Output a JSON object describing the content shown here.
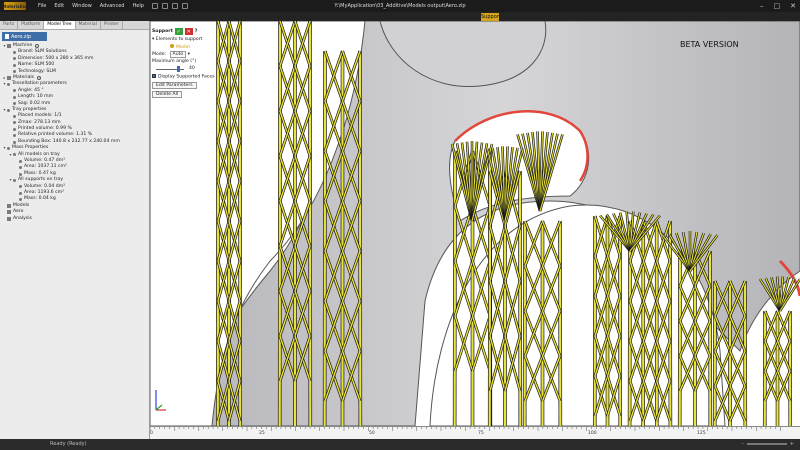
{
  "app": {
    "logo": "Materialise",
    "menu": [
      "File",
      "Edit",
      "Window",
      "Advanced",
      "Help"
    ],
    "path": "Y:\\MyApplication\\03_Additive\\Models output\\Aero.zip",
    "context_tab": "Support",
    "window_controls": [
      "–",
      "□",
      "✕"
    ]
  },
  "sidebar": {
    "tabs": [
      "Parts",
      "Platform",
      "Model Tree",
      "Material",
      "Printer"
    ],
    "active_tab": "Model Tree",
    "file_tab": "Aero.zip",
    "tree": [
      {
        "indent": 0,
        "caret": "▾",
        "icon": "sq",
        "label": "Machine",
        "gear": true
      },
      {
        "indent": 1,
        "caret": "",
        "icon": "dot",
        "label": "Brand: SLM Solutions"
      },
      {
        "indent": 1,
        "caret": "",
        "icon": "dot",
        "label": "Dimension: 500 x 280 x 365 mm"
      },
      {
        "indent": 1,
        "caret": "",
        "icon": "dot",
        "label": "Name: SLM 500"
      },
      {
        "indent": 1,
        "caret": "",
        "icon": "dot",
        "label": "Technology: SLM"
      },
      {
        "indent": 0,
        "caret": "▸",
        "icon": "sq",
        "label": "Materials",
        "gear": true
      },
      {
        "indent": 0,
        "caret": "▾",
        "icon": "dot",
        "label": "Tessellation parameters"
      },
      {
        "indent": 1,
        "caret": "",
        "icon": "dot",
        "label": "Angle: 45 °"
      },
      {
        "indent": 1,
        "caret": "",
        "icon": "dot",
        "label": "Length: 10 mm"
      },
      {
        "indent": 1,
        "caret": "",
        "icon": "dot",
        "label": "Sag: 0.02 mm"
      },
      {
        "indent": 0,
        "caret": "▾",
        "icon": "dot",
        "label": "Tray properties"
      },
      {
        "indent": 1,
        "caret": "",
        "icon": "dot",
        "label": "Placed models: 1/1"
      },
      {
        "indent": 1,
        "caret": "",
        "icon": "dot",
        "label": "Zmax: 278.13 mm"
      },
      {
        "indent": 1,
        "caret": "",
        "icon": "dot",
        "label": "Printed volume: 0.99 %"
      },
      {
        "indent": 1,
        "caret": "",
        "icon": "dot",
        "label": "Relative printed volume: 1.31 %"
      },
      {
        "indent": 1,
        "caret": "",
        "icon": "dot",
        "label": "Bounding Box: 140.8 x 232.77 x 240.04 mm"
      },
      {
        "indent": 0,
        "caret": "▾",
        "icon": "dot",
        "label": "Mass Properties"
      },
      {
        "indent": 1,
        "caret": "▾",
        "icon": "dot",
        "label": "All models on tray"
      },
      {
        "indent": 2,
        "caret": "",
        "icon": "dot",
        "label": "Volume: 0.47 dm³"
      },
      {
        "indent": 2,
        "caret": "",
        "icon": "dot",
        "label": "Area: 1037.11 cm²"
      },
      {
        "indent": 2,
        "caret": "",
        "icon": "dot",
        "label": "Mass: 0.47 kg"
      },
      {
        "indent": 1,
        "caret": "▾",
        "icon": "dot",
        "label": "All supports on tray"
      },
      {
        "indent": 2,
        "caret": "",
        "icon": "dot",
        "label": "Volume: 0.04 dm³"
      },
      {
        "indent": 2,
        "caret": "",
        "icon": "dot",
        "label": "Area: 1193.6 cm²"
      },
      {
        "indent": 2,
        "caret": "",
        "icon": "dot",
        "label": "Mass: 0.04 kg"
      },
      {
        "indent": 0,
        "caret": "",
        "icon": "sq",
        "label": "Models"
      },
      {
        "indent": 0,
        "caret": "",
        "icon": "sq",
        "label": "Aero"
      },
      {
        "indent": 0,
        "caret": "",
        "icon": "sq",
        "label": "Analysis"
      }
    ]
  },
  "panel": {
    "title": "Support",
    "ok_symbol": "✓",
    "cancel_symbol": "✕",
    "help": "?",
    "elements_label": "Elements to support",
    "model_label": "Model",
    "mode_label": "Mode:",
    "mode_value": "Auto",
    "max_angle_label": "Maximum angle (°)",
    "max_angle_value": "40",
    "display_label": "Display Supported Faces",
    "edit_button": "Edit Parameters",
    "delete_button": "Delete All"
  },
  "viewport": {
    "badge": "BETA VERSION",
    "ruler_labels": [
      "0",
      "25",
      "50",
      "75",
      "100",
      "125"
    ]
  },
  "status": {
    "text": "Ready (Ready)"
  },
  "colors": {
    "part_gray": "#c9c9cc",
    "support_yellow": "#e9e23a",
    "support_outline": "#1a1a1a",
    "overhang_red": "#e2473b",
    "accent_gold": "#d7a31b"
  }
}
